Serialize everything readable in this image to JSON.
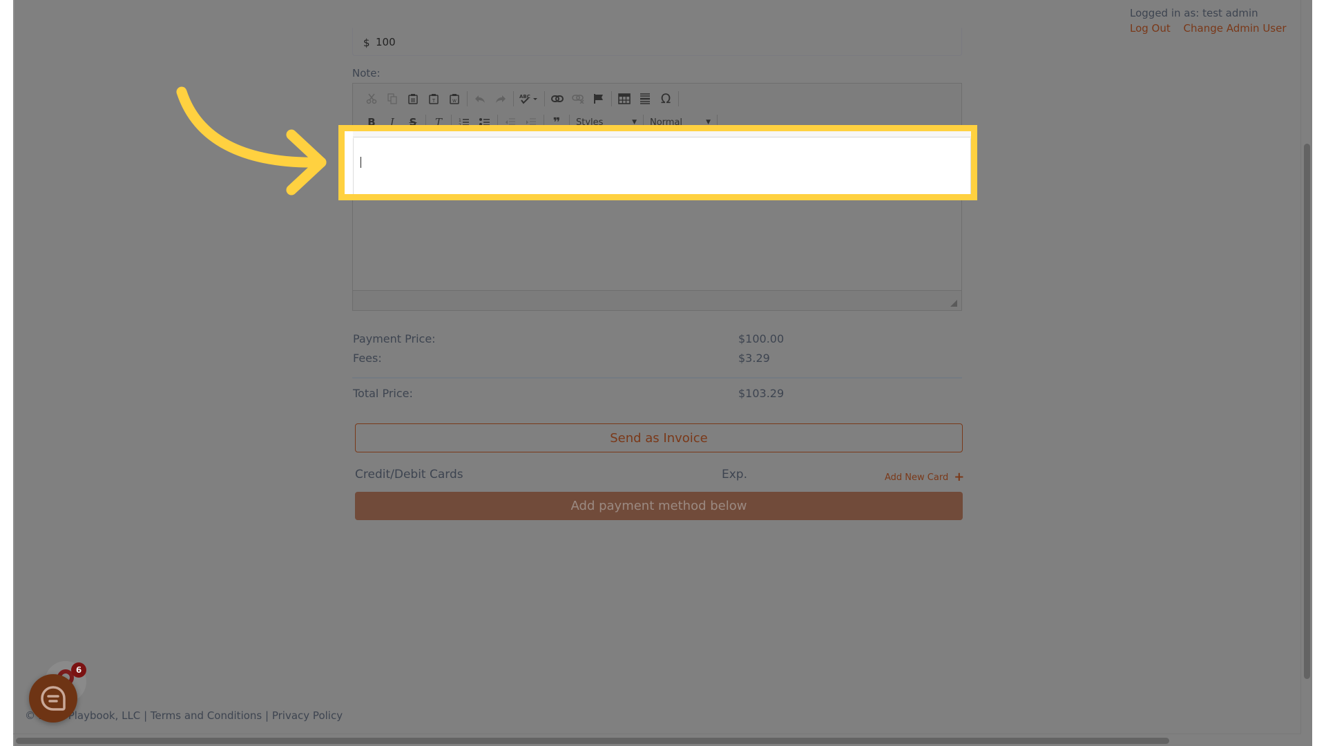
{
  "header": {
    "logged_in_text": "Logged in as: test admin",
    "log_out_label": "Log Out",
    "change_admin_label": "Change Admin User"
  },
  "amount_field": {
    "currency_symbol": "$",
    "value": "100"
  },
  "note": {
    "label": "Note:",
    "toolbar": {
      "row1": [
        "cut",
        "copy",
        "paste",
        "paste-as-text",
        "paste-from-word",
        "undo",
        "redo",
        "spellcheck",
        "link",
        "unlink",
        "anchor",
        "table",
        "horizontal-rule",
        "special-character"
      ],
      "row2": [
        "bold",
        "italic",
        "strikethrough",
        "remove-format",
        "numbered-list",
        "bulleted-list",
        "decrease-indent",
        "increase-indent",
        "blockquote"
      ],
      "styles_label": "Styles",
      "format_label": "Normal",
      "glyphs": {
        "bold": "B",
        "italic": "I",
        "strike": "S",
        "remove_format": "T",
        "blockquote": "❞",
        "omega": "Ω",
        "spell": "ABC"
      }
    },
    "content": ""
  },
  "pricing": {
    "payment_price_label": "Payment Price:",
    "payment_price_value": "$100.00",
    "fees_label": "Fees:",
    "fees_value": "$3.29",
    "total_label": "Total Price:",
    "total_value": "$103.29"
  },
  "actions": {
    "send_invoice_label": "Send as Invoice",
    "cards_label": "Credit/Debit Cards",
    "exp_label": "Exp.",
    "add_card_label": "Add New Card",
    "add_card_icon": "+",
    "add_payment_label": "Add payment method below"
  },
  "footer": {
    "copyright": "© 2022 Playbook, LLC",
    "separator": "|",
    "terms_label": "Terms and Conditions",
    "privacy_label": "Privacy Policy"
  },
  "chat": {
    "badge_count": "6"
  },
  "annotation": {
    "highlight_color": "#FFD140"
  },
  "colors": {
    "accent": "#7A3818",
    "primary_button": "#714B3A",
    "overlay_bg": "#808080"
  }
}
